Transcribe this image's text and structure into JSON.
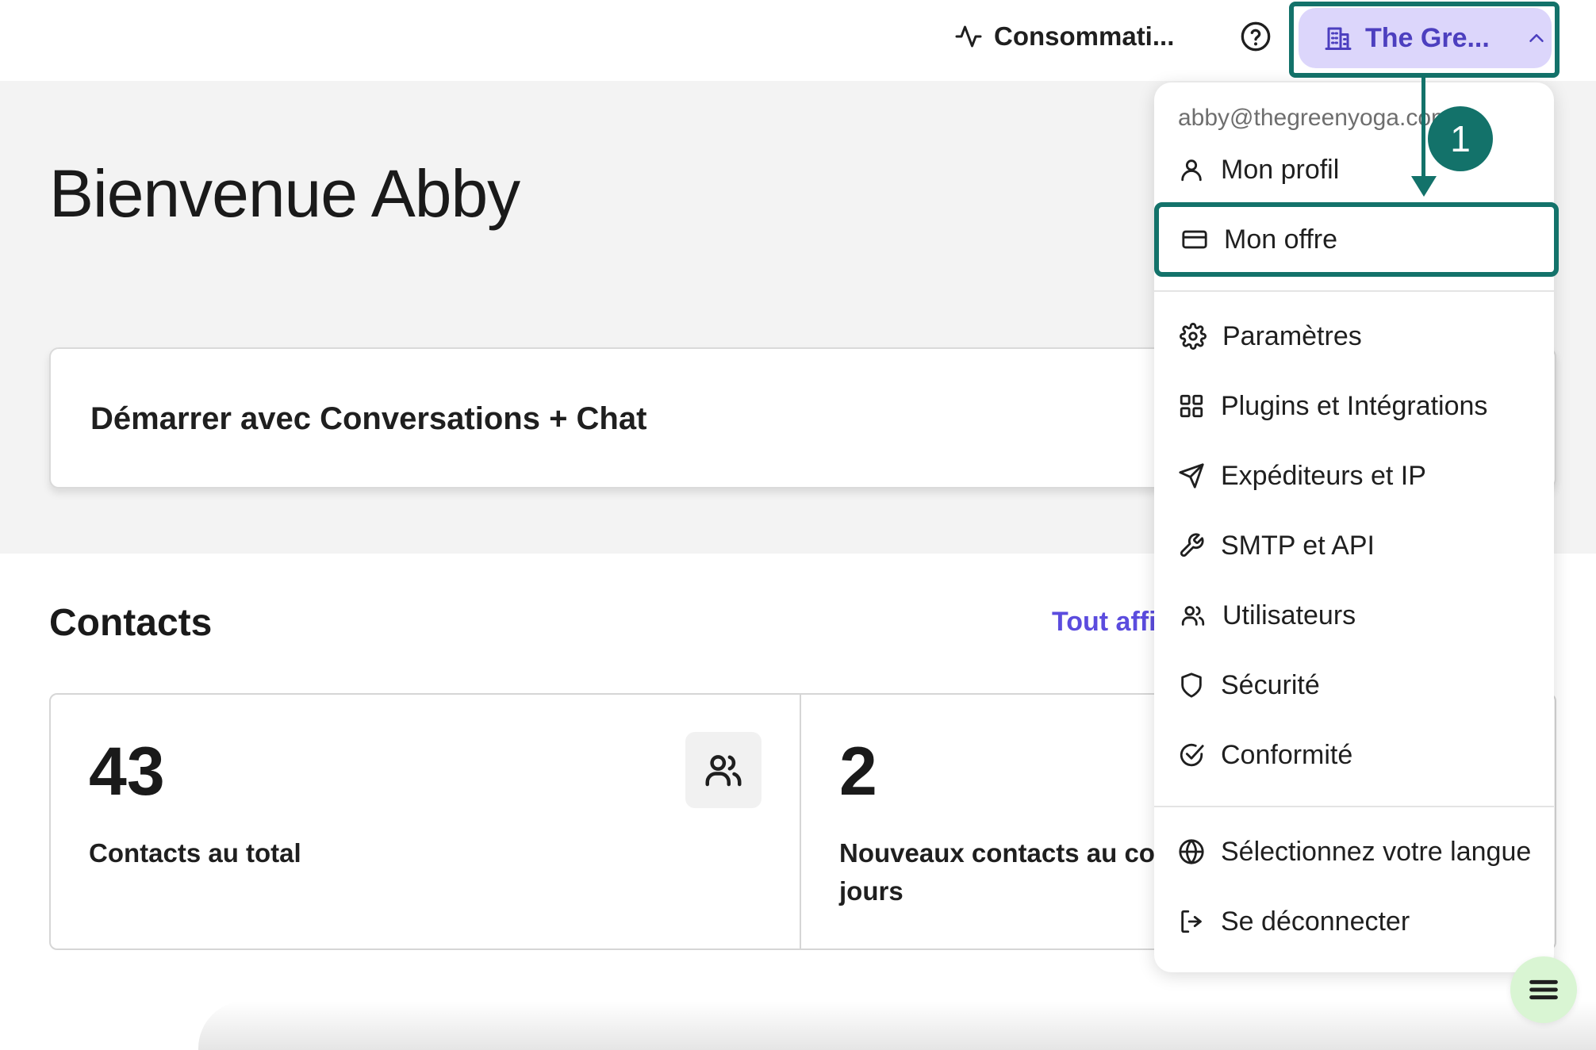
{
  "topbar": {
    "usage_label": "Consommati...",
    "usage_icon": "activity-icon",
    "help_icon": "help-circle-icon",
    "org_label": "The Gre...",
    "org_icon": "building-icon",
    "org_chevron": "chevron-up-icon"
  },
  "hero": {
    "welcome": "Bienvenue Abby",
    "start_card": "Démarrer avec Conversations + Chat"
  },
  "contacts": {
    "title": "Contacts",
    "show_all": "Tout affi",
    "stats": [
      {
        "value": "43",
        "label": "Contacts au total",
        "icon": "users-icon"
      },
      {
        "value": "2",
        "label_line1": "Nouveaux contacts au cou",
        "label_line2": "jours"
      }
    ]
  },
  "menu": {
    "email": "abby@thegreenyoga.com",
    "items": [
      {
        "label": "Mon profil",
        "icon": "user-icon"
      },
      {
        "label": "Mon offre",
        "icon": "credit-card-icon"
      },
      {
        "label": "Paramètres",
        "icon": "gear-icon"
      },
      {
        "label": "Plugins et Intégrations",
        "icon": "grid-icon"
      },
      {
        "label": "Expéditeurs et IP",
        "icon": "send-icon"
      },
      {
        "label": "SMTP et API",
        "icon": "wrench-icon"
      },
      {
        "label": "Utilisateurs",
        "icon": "users-icon"
      },
      {
        "label": "Sécurité",
        "icon": "shield-icon"
      },
      {
        "label": "Conformité",
        "icon": "check-circle-icon"
      },
      {
        "label": "Sélectionnez votre langue",
        "icon": "globe-icon"
      },
      {
        "label": "Se déconnecter",
        "icon": "logout-icon"
      }
    ]
  },
  "annotation": {
    "step_number": "1",
    "color": "#13726a"
  },
  "colors": {
    "accent": "#5b4cde",
    "org_button_bg": "#dcd6fb",
    "org_button_text": "#4c3fbf",
    "fab_bg": "#d9f5d3"
  },
  "fab_icon": "menu-icon"
}
